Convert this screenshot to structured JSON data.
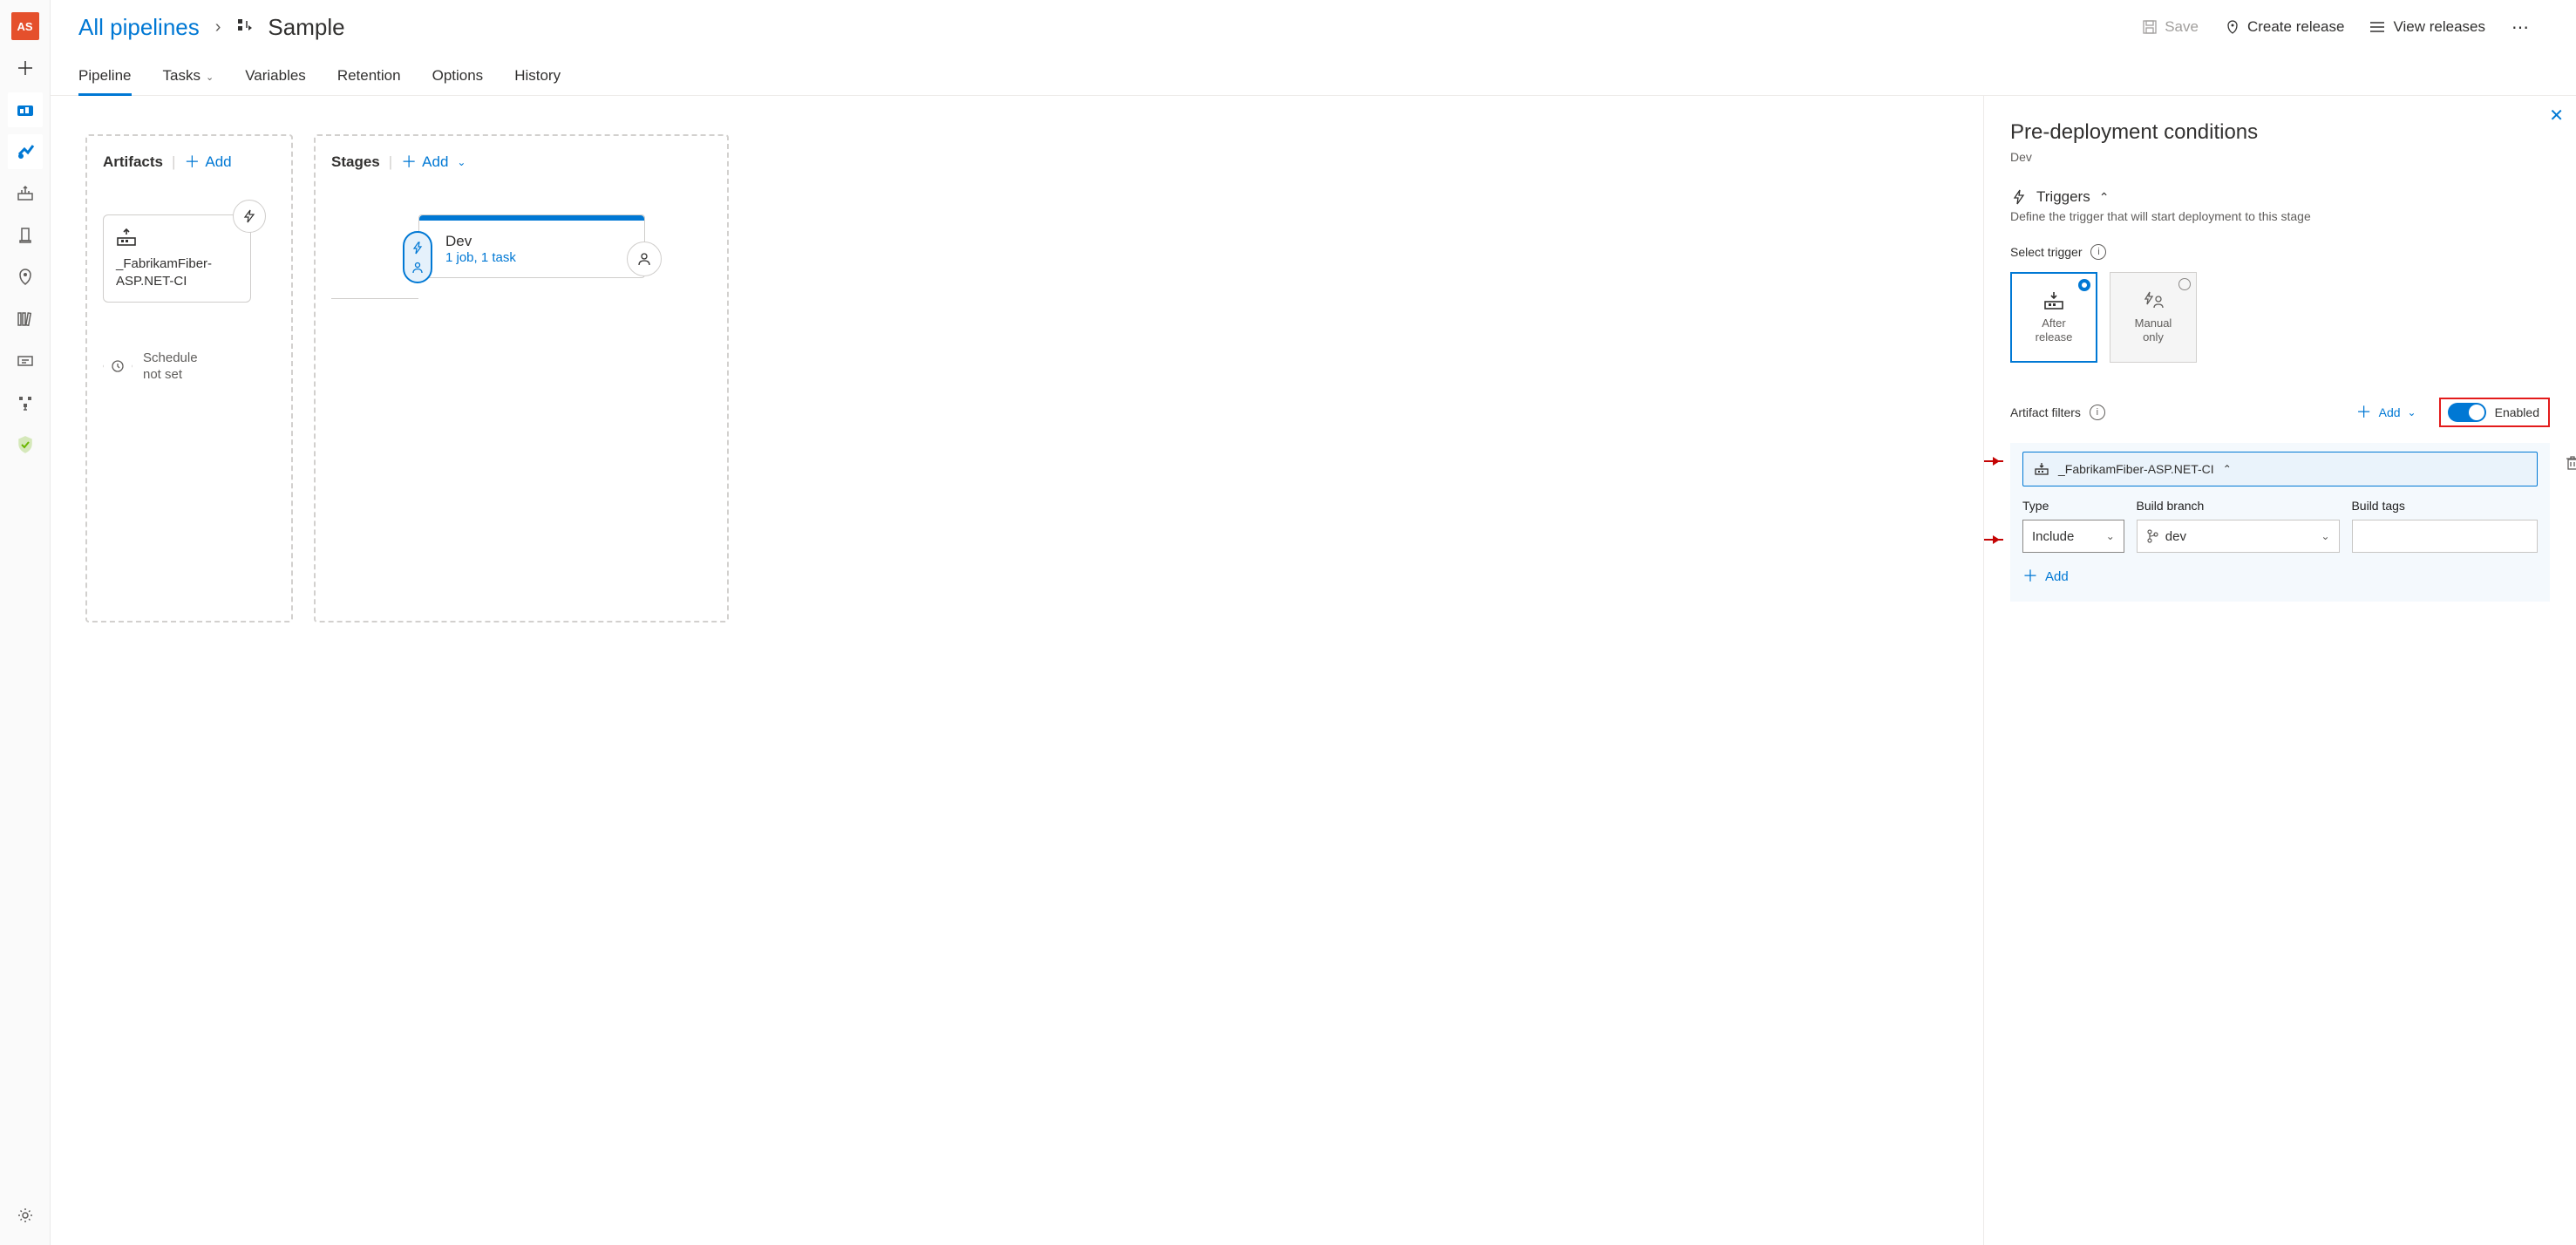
{
  "breadcrumb": {
    "root": "All pipelines",
    "title": "Sample"
  },
  "actions": {
    "save": "Save",
    "create_release": "Create release",
    "view_releases": "View releases"
  },
  "tabs": {
    "pipeline": "Pipeline",
    "tasks": "Tasks",
    "variables": "Variables",
    "retention": "Retention",
    "options": "Options",
    "history": "History"
  },
  "artifacts": {
    "heading": "Artifacts",
    "add": "Add",
    "item_name": "_FabrikamFiber-ASP.NET-CI",
    "schedule_l1": "Schedule",
    "schedule_l2": "not set"
  },
  "stages": {
    "heading": "Stages",
    "add": "Add",
    "stage_name": "Dev",
    "stage_sub": "1 job, 1 task"
  },
  "panel": {
    "title": "Pre-deployment conditions",
    "subtitle": "Dev",
    "triggers_head": "Triggers",
    "triggers_desc": "Define the trigger that will start deployment to this stage",
    "select_trigger": "Select trigger",
    "after_l1": "After",
    "after_l2": "release",
    "manual_l1": "Manual",
    "manual_l2": "only",
    "filters_head": "Artifact filters",
    "filters_add": "Add",
    "filters_enabled": "Enabled",
    "filter_name": "_FabrikamFiber-ASP.NET-CI",
    "col_type": "Type",
    "col_branch": "Build branch",
    "col_tags": "Build tags",
    "type_value": "Include",
    "branch_value": "dev",
    "add_row": "Add"
  },
  "logo": "AS"
}
